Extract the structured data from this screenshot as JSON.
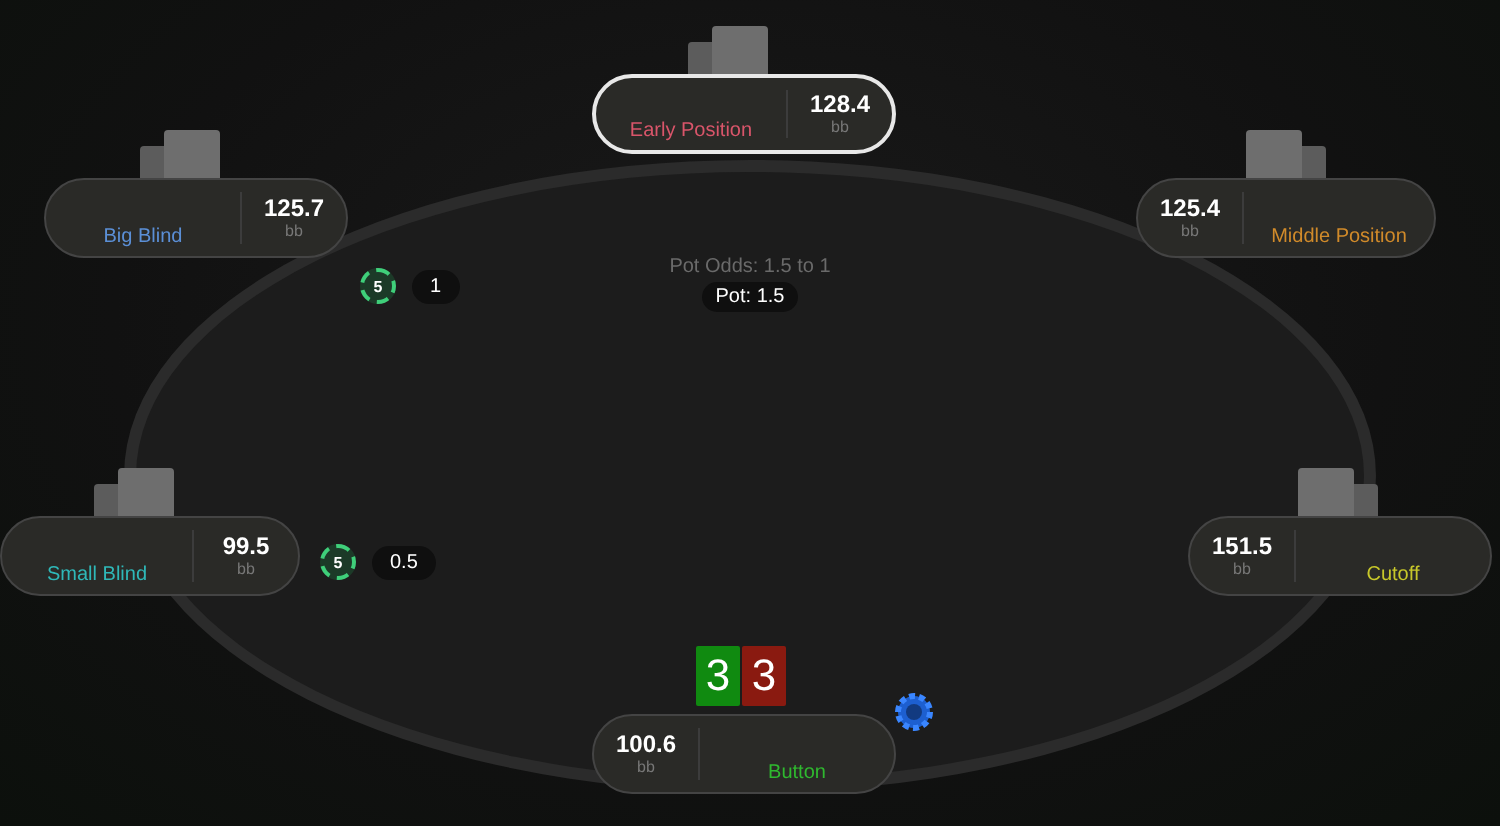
{
  "pot_odds": "Pot Odds: 1.5 to 1",
  "pot": "Pot: 1.5",
  "seats": [
    {
      "name": "Early Position",
      "stack": "128.4",
      "unit": "bb",
      "color": "#d9556a",
      "active": true,
      "dealer": false,
      "card_backs": true
    },
    {
      "name": "Big Blind",
      "stack": "125.7",
      "unit": "bb",
      "color": "#5b8fd6",
      "active": false,
      "dealer": false,
      "card_backs": true,
      "bet": {
        "chip": "5",
        "amount": "1"
      }
    },
    {
      "name": "Middle Position",
      "stack": "125.4",
      "unit": "bb",
      "color": "#d08a2a",
      "active": false,
      "dealer": false,
      "card_backs": true
    },
    {
      "name": "Small Blind",
      "stack": "99.5",
      "unit": "bb",
      "color": "#2fb8b8",
      "active": false,
      "dealer": false,
      "card_backs": true,
      "bet": {
        "chip": "5",
        "amount": "0.5"
      }
    },
    {
      "name": "Cutoff",
      "stack": "151.5",
      "unit": "bb",
      "color": "#c8c82a",
      "active": false,
      "dealer": false,
      "card_backs": true
    },
    {
      "name": "Button",
      "stack": "100.6",
      "unit": "bb",
      "color": "#2fb82f",
      "active": false,
      "dealer": true,
      "card_backs": false
    }
  ],
  "hole_cards": [
    {
      "rank": "3",
      "color": "#108a10"
    },
    {
      "rank": "3",
      "color": "#8a1a10"
    }
  ]
}
